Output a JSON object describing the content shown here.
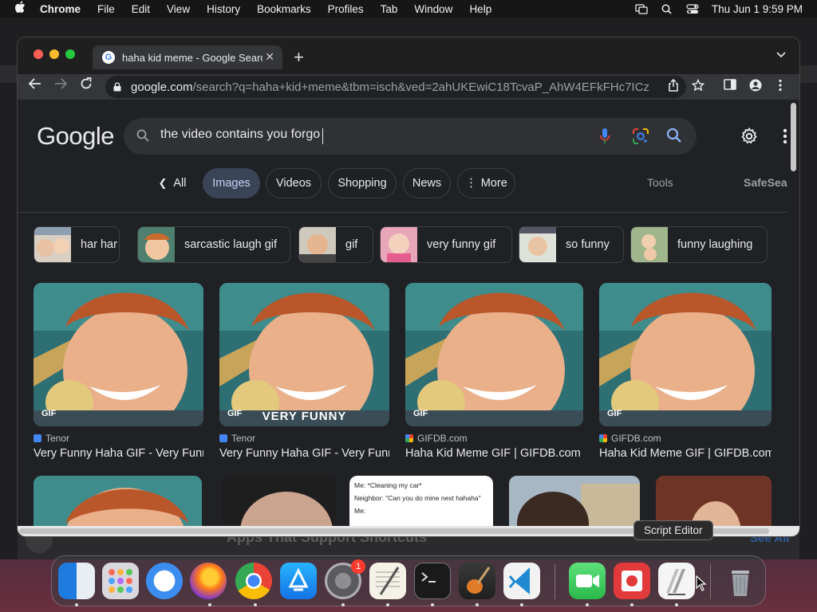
{
  "menubar": {
    "app": "Chrome",
    "items": [
      "File",
      "Edit",
      "View",
      "History",
      "Bookmarks",
      "Profiles",
      "Tab",
      "Window",
      "Help"
    ],
    "datetime": "Thu Jun 1  9:59 PM"
  },
  "browser": {
    "tab_title": "haha kid meme - Google Search",
    "url_host": "google.com",
    "url_path": "/search?q=haha+kid+meme&tbm=isch&ved=2ahUKEwiC18TcvaP_AhW4EFkFHc7ICz4..."
  },
  "search": {
    "logo": "Google",
    "query": "the video contains you forgo"
  },
  "filters": {
    "all": "All",
    "tabs": [
      "Images",
      "Videos",
      "Shopping",
      "News"
    ],
    "more": "More",
    "tools": "Tools",
    "safesearch": "SafeSearch"
  },
  "chips": [
    "har har",
    "sarcastic laugh gif",
    "gif",
    "very funny gif",
    "so funny",
    "funny laughing"
  ],
  "results": [
    {
      "source": "Tenor",
      "title": "Very Funny Haha GIF - Very Funny Haha Laugh",
      "badge": "GIF",
      "overlay": ""
    },
    {
      "source": "Tenor",
      "title": "Very Funny Haha GIF - Very Funny Haha Laugh",
      "badge": "GIF",
      "overlay": "VERY FUNNY"
    },
    {
      "source": "GIFDB.com",
      "title": "Haha Kid Meme GIF | GIFDB.com",
      "badge": "GIF",
      "overlay": ""
    },
    {
      "source": "GIFDB.com",
      "title": "Haha Kid Meme GIF | GIFDB.com",
      "badge": "GIF",
      "overlay": ""
    }
  ],
  "row2_text": {
    "line1": "Me: *Cleaning my car*",
    "line2": "Neighbor: \"Can you do mine next hahaha\"",
    "line3": "Me:"
  },
  "background_window": {
    "text": "Apps That Support Shortcuts",
    "link": "See All"
  },
  "tooltip": "Script Editor",
  "dock": {
    "settings_badge": "1"
  }
}
